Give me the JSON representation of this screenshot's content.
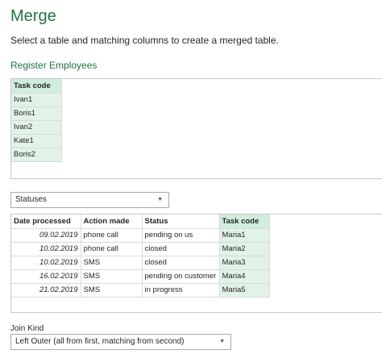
{
  "header": {
    "title": "Merge",
    "subtitle": "Select a table and matching columns to create a merged table."
  },
  "table1": {
    "name": "Register Employees",
    "columns": [
      "Task code"
    ],
    "rows": [
      [
        "Ivan1"
      ],
      [
        "Boris1"
      ],
      [
        "Ivan2"
      ],
      [
        "Kate1"
      ],
      [
        "Boris2"
      ]
    ]
  },
  "table_select": {
    "value": "Statuses",
    "icon": "chevron-down-icon"
  },
  "table2": {
    "columns": [
      "Date processed",
      "Action made",
      "Status",
      "Task code"
    ],
    "rows": [
      [
        "09.02.2019",
        "phone call",
        "pending on us",
        "Maria1"
      ],
      [
        "10.02.2019",
        "phone call",
        "closed",
        "Maria2"
      ],
      [
        "10.02.2019",
        "SMS",
        "closed",
        "Maria3"
      ],
      [
        "16.02.2019",
        "SMS",
        "pending on customer",
        "Maria4"
      ],
      [
        "21.02.2019",
        "SMS",
        "in progress",
        "Maria5"
      ]
    ]
  },
  "join": {
    "label": "Join Kind",
    "value": "Left Outer (all from first, matching from second)",
    "icon": "chevron-down-icon"
  },
  "colors": {
    "accent": "#217346",
    "selected_column": "#e1f3e7"
  }
}
